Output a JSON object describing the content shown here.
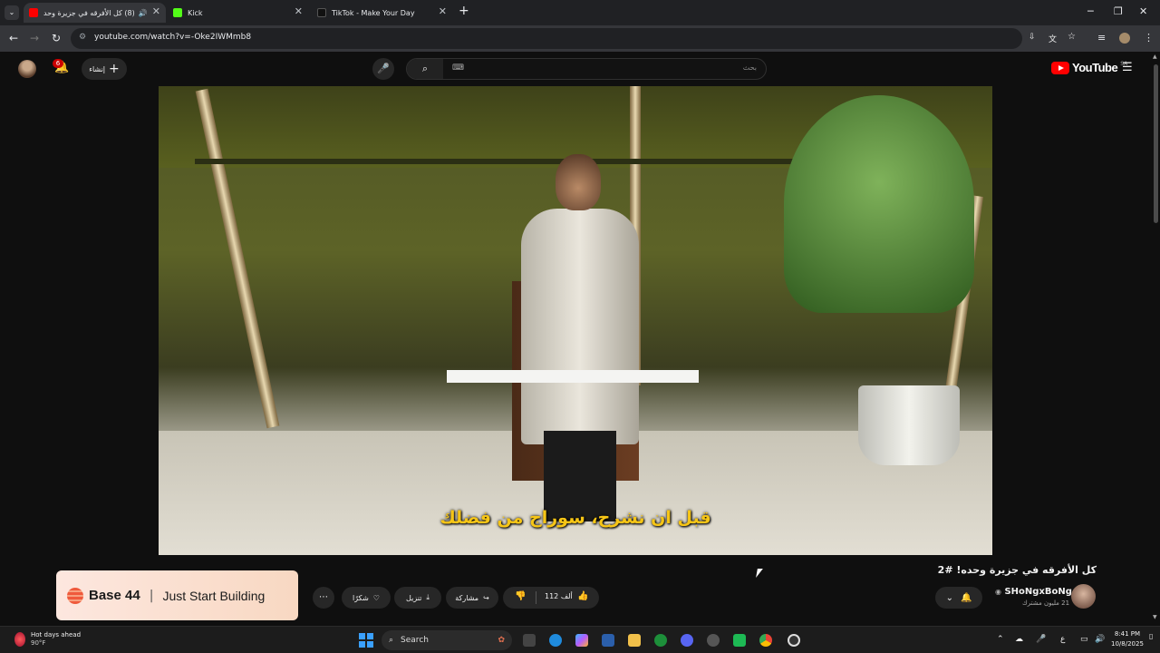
{
  "browser": {
    "tabs": [
      {
        "title": "(8) كل الأفرقه في جزيرة وحد",
        "active": true
      },
      {
        "title": "Kick",
        "active": false
      },
      {
        "title": "TikTok - Make Your Day",
        "active": false
      }
    ],
    "url": "youtube.com/watch?v=-Oke2IWMmb8"
  },
  "header": {
    "notification_count": "6",
    "create_label": "إنشاء",
    "search_placeholder": "بحث",
    "logo_text": "YouTube",
    "country_code": "SA"
  },
  "video": {
    "subtitle": "قبل ان نشرح، سوراج من فضلك"
  },
  "ad": {
    "brand": "Base 44",
    "separator": "|",
    "tagline": "Just Start Building"
  },
  "actions": {
    "more": "⋯",
    "thanks_label": "شكرًا",
    "download_label": "تنزيل",
    "share_label": "مشاركة",
    "likes_label": "112 ألف"
  },
  "details": {
    "title": "كل الأفرقه في جزيرة وحده! #2",
    "channel_name": "SHoNgxBoNg",
    "subscribers": "21 مليون مشترك"
  },
  "taskbar": {
    "weather_title": "Hot days ahead",
    "weather_temp": "90°F",
    "search_label": "Search",
    "time": "8:41 PM",
    "date": "10/8/2025",
    "lang": "ع"
  }
}
